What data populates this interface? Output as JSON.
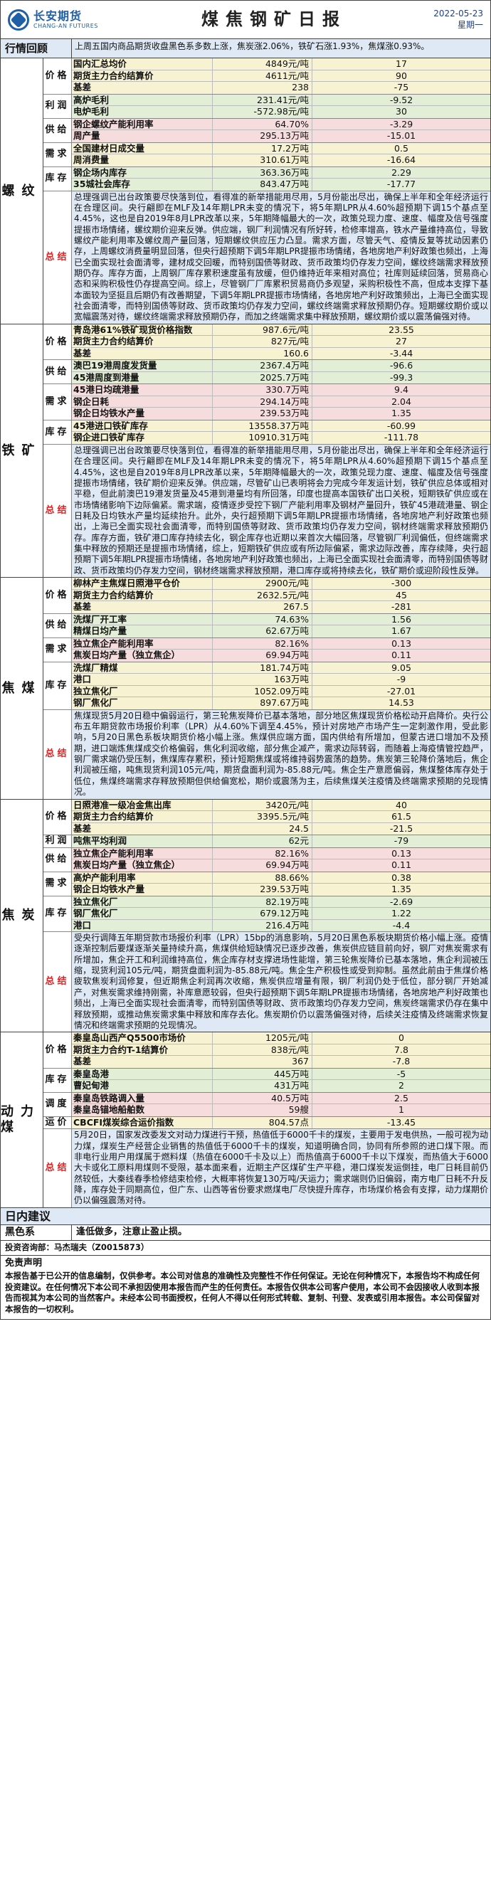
{
  "header": {
    "logo_cn": "长安期货",
    "logo_en": "CHANG-AN FUTURES",
    "title": "煤焦钢矿日报",
    "date": "2022-05-23",
    "weekday": "星期一"
  },
  "review": {
    "label": "行情回顾",
    "text": "上周五国内商品期货收盘黑色系多数上涨，焦炭涨2.06%，铁矿石涨1.93%，焦煤涨0.93%。"
  },
  "sections": {
    "rebar": {
      "name": "螺纹",
      "groups": [
        {
          "label": "价格",
          "rows": [
            {
              "name": "国内汇总均价",
              "value": "4849元/吨",
              "change": "17",
              "bg": "y"
            },
            {
              "name": "期货主力合约结算价",
              "value": "4611元/吨",
              "change": "90",
              "bg": "y"
            },
            {
              "name": "基差",
              "value": "238",
              "change": "-75",
              "bg": "y"
            }
          ]
        },
        {
          "label": "利润",
          "rows": [
            {
              "name": "高炉毛利",
              "value": "231.41元/吨",
              "change": "-9.52",
              "bg": "g"
            },
            {
              "name": "电炉毛利",
              "value": "-572.98元/吨",
              "change": "30",
              "bg": "g"
            }
          ]
        },
        {
          "label": "供给",
          "rows": [
            {
              "name": "钢企螺纹产能利用率",
              "value": "64.70%",
              "change": "-3.29",
              "bg": "p"
            },
            {
              "name": "周产量",
              "value": "295.13万吨",
              "change": "-15.01",
              "bg": "p"
            }
          ]
        },
        {
          "label": "需求",
          "rows": [
            {
              "name": "全国建材日成交量",
              "value": "17.2万吨",
              "change": "0.5",
              "bg": "y"
            },
            {
              "name": "周消费量",
              "value": "310.61万吨",
              "change": "-16.64",
              "bg": "y"
            }
          ]
        },
        {
          "label": "库存",
          "rows": [
            {
              "name": "钢企场内库存",
              "value": "363.36万吨",
              "change": "2.29",
              "bg": "g"
            },
            {
              "name": "35城社会库存",
              "value": "843.47万吨",
              "change": "-17.77",
              "bg": "g"
            }
          ]
        }
      ],
      "summary_label": "总结",
      "summary": "总理强调已出台政策要尽快落到位，看得准的新举措能用尽用，5月份能出尽出，确保上半年和全年经济运行在合理区间。央行翩即在MLF及14年期LPR未变的情况下，将5年期LPR从4.60%超预期下调15个基点至4.45%，这也是自2019年8月LPR改革以来，5年期降幅最大的一次，政策兑现力度、速度、幅度及信号强度提振市场情绪，螺纹期价迎来反弹。供应端，钢厂利润情况有所好转，检修率增高，铁水产量维持高位，导致螺纹产能利用率及螺纹周产量回落，短期螺纹供应压力凸显。需求方面，尽管天气、疫情反复等扰动因素仍存，上周螺纹消费量明显回落，但央行超预期下调5年期LPR提振市场情绪，各地房地产利好政策也频出，上海已全面实现社会面清零，建材成交回暖，而特别国债等财政、货币政策均仍存发力空间，螺纹终端需求释放预期仍存。库存方面，上周钢厂库存累积速度虽有放缓，但仍维持近年来相对高位；社库则延续回落，贸易商心态和采购积极性仍存提高空间。综上，尽管钢厂厂库累积贸易商仍多观望，采购积极性不高，但成本支撑下基本面较为坚挺且后期仍有改善期望，下调5年期LPR提振市场情绪，各地房地产利好政策频出，上海已全面实现社会面清零，而特别国债等财政、货币政策均仍存发力空间，螺纹终端需求释放预期仍存。短期螺纹期价或以宽幅震荡对待，螺纹终端需求释放预期仍存，而加之终端需求集中释放预期，螺纹期价或以震荡偏强对待。"
    },
    "ore": {
      "name": "铁矿",
      "groups": [
        {
          "label": "价格",
          "rows": [
            {
              "name": "青岛港61%铁矿现货价格指数",
              "value": "987.6元/吨",
              "change": "23.55",
              "bg": "y"
            },
            {
              "name": "期货主力合约结算价",
              "value": "827元/吨",
              "change": "27",
              "bg": "y"
            },
            {
              "name": "基差",
              "value": "160.6",
              "change": "-3.44",
              "bg": "y"
            }
          ]
        },
        {
          "label": "供给",
          "rows": [
            {
              "name": "澳巴19港周度发货量",
              "value": "2367.4万吨",
              "change": "-96.6",
              "bg": "g"
            },
            {
              "name": "45港周度到港量",
              "value": "2025.7万吨",
              "change": "-99.3",
              "bg": "g"
            }
          ]
        },
        {
          "label": "需求",
          "rows": [
            {
              "name": "45港日均疏港量",
              "value": "330.7万吨",
              "change": "9.4",
              "bg": "p"
            },
            {
              "name": "钢企日耗",
              "value": "294.14万吨",
              "change": "2.04",
              "bg": "p"
            },
            {
              "name": "钢企日均铁水产量",
              "value": "239.53万吨",
              "change": "1.35",
              "bg": "p"
            }
          ]
        },
        {
          "label": "库存",
          "rows": [
            {
              "name": "45港进口铁矿库存",
              "value": "13558.37万吨",
              "change": "-60.99",
              "bg": "y"
            },
            {
              "name": "钢企进口铁矿库存",
              "value": "10910.31万吨",
              "change": "-111.78",
              "bg": "y"
            }
          ]
        }
      ],
      "summary_label": "总结",
      "summary": "总理强调已出台政策要尽快落到位，看得准的新举措能用尽用，5月份能出尽出，确保上半年和全年经济运行在合理区间。央行翩即在MLF及14年期LPR未变的情况下，将5年期LPR从4.60%超预期下调15个基点至4.45%，这也是自2019年8月LPR改革以来，5年期降幅最大的一次，政策兑现力度、速度、幅度及信号强度提振市场情绪，铁矿期价迎来反弹。供应端，尽管矿山已表明将会力完成今年发运计划，铁矿供应总体或相对平稳，但此前澳巴19港发货量及45港到港量均有所回落，印度也提高本国铁矿出口关税，短期铁矿供应或在市场情绪影响下边际偏紧。需求端，疫情逐步受控下钢厂产能利用率及钢材产量回升，铁矿45港疏港量、钢企日耗及日均铁水产量均延续抬升。此外，央行超预期下调5年期LPR提振市场情绪，各地房地产利好政策也频出，上海已全面实现社会面清零，而特别国债等财政、货币政策均仍存发力空间，钢材终端需求释放预期仍存。库存方面，铁矿港口库存持续去化，钢企库存也近期以来首次大幅回落，尽管钢厂利润偏低，但终端需求集中释放的预期还是提振市场情绪，综上，短期铁矿供应或有所边际偏紧，需求边际改善，库存续降，央行超预期下调5年期LPR提振市场情绪，各地房地产利好政策也频出，上海已全面实现社会面清零，而特别国债等财政、货币政策均仍存发力空间，钢材终端需求释放预期，港口库存或将持续去化，铁矿期价或迎阶段性反弹。"
    },
    "coking_coal": {
      "name": "焦煤",
      "groups": [
        {
          "label": "价格",
          "rows": [
            {
              "name": "柳林产主焦煤日照港平仓价",
              "value": "2900元/吨",
              "change": "-300",
              "bg": "y"
            },
            {
              "name": "期货主力合约结算价",
              "value": "2632.5元/吨",
              "change": "45",
              "bg": "y"
            },
            {
              "name": "基差",
              "value": "267.5",
              "change": "-281",
              "bg": "y"
            }
          ]
        },
        {
          "label": "供给",
          "rows": [
            {
              "name": "洗煤厂开工率",
              "value": "74.63%",
              "change": "1.56",
              "bg": "g"
            },
            {
              "name": "精煤日均产量",
              "value": "62.67万吨",
              "change": "1.67",
              "bg": "g"
            }
          ]
        },
        {
          "label": "需求",
          "rows": [
            {
              "name": "独立焦企产能利用率",
              "value": "82.16%",
              "change": "0.13",
              "bg": "p"
            },
            {
              "name": "焦炭日均产量（独立焦企）",
              "value": "69.94万吨",
              "change": "0.11",
              "bg": "p"
            }
          ]
        },
        {
          "label": "库存",
          "rows": [
            {
              "name": "洗煤厂精煤",
              "value": "181.74万吨",
              "change": "9.05",
              "bg": "y"
            },
            {
              "name": "港口",
              "value": "163万吨",
              "change": "-9",
              "bg": "y"
            },
            {
              "name": "独立焦化厂",
              "value": "1052.09万吨",
              "change": "-27.01",
              "bg": "y"
            },
            {
              "name": "钢厂焦化厂",
              "value": "897.67万吨",
              "change": "14.53",
              "bg": "y"
            }
          ]
        }
      ],
      "summary_label": "总结",
      "summary": "焦煤现货5月20日稳中偏弱运行，第三轮焦炭降价已基本落地，部分地区焦煤现货价格松动开启降价。央行公布五年期贷款市场报价利率（LPR）从4.60%下调至4.45%，预计对房地产市场产生一定刺激作用，受此影响，5月20日黑色系板块期货价格小幅上涨。焦煤供应端方面，国内供给有所增加，但蒙古进口增加不及预期，进口端炼焦煤成交价格偏弱，焦化利润收缩，部分焦企减产，需求边际转弱，而随着上海疫情管控趋严，钢厂需求端仍受压制，焦煤库存累积，预计短期焦煤或将维持弱势震荡的趋势。焦炭第三轮降价落地后，焦企利润被压缩，吨焦现货利润105元/吨，期货盘面利润为-85.88元/吨。焦企生产意愿偏弱，焦煤整体库存处于低位，焦煤终端需求存释放预期但供给偏宽松，期价或震荡为主，后续焦煤关注疫情及终端需求预期的兑现情况。"
    },
    "coke": {
      "name": "焦炭",
      "groups": [
        {
          "label": "价格",
          "rows": [
            {
              "name": "日照港准一级冶金焦出库",
              "value": "3420元/吨",
              "change": "40",
              "bg": "y"
            },
            {
              "name": "期货主力合约结算价",
              "value": "3395.5元/吨",
              "change": "61.5",
              "bg": "y"
            },
            {
              "name": "基差",
              "value": "24.5",
              "change": "-21.5",
              "bg": "y"
            }
          ]
        },
        {
          "label": "利润",
          "rows": [
            {
              "name": "吨焦平均利润",
              "value": "62元",
              "change": "-79",
              "bg": "g"
            }
          ]
        },
        {
          "label": "供给",
          "rows": [
            {
              "name": "独立焦企产能利用率",
              "value": "82.16%",
              "change": "0.13",
              "bg": "p"
            },
            {
              "name": "焦炭日均产量（独立焦企）",
              "value": "69.94万吨",
              "change": "0.11",
              "bg": "p"
            }
          ]
        },
        {
          "label": "需求",
          "rows": [
            {
              "name": "高炉产能利用率",
              "value": "88.66%",
              "change": "0.38",
              "bg": "y"
            },
            {
              "name": "钢企日均铁水产量",
              "value": "239.53万吨",
              "change": "1.35",
              "bg": "y"
            }
          ]
        },
        {
          "label": "库存",
          "rows": [
            {
              "name": "独立焦化厂",
              "value": "82.19万吨",
              "change": "-2.69",
              "bg": "g"
            },
            {
              "name": "钢厂焦化厂",
              "value": "679.12万吨",
              "change": "1.22",
              "bg": "g"
            },
            {
              "name": "港口",
              "value": "216.4万吨",
              "change": "-4.4",
              "bg": "g"
            }
          ]
        }
      ],
      "summary_label": "总结",
      "summary": "受央行调降五年期贷款市场报价利率（LPR）15bp的消息影响，5月20日黑色系板块期货价格小幅上涨。疫情逐渐控制后要煤逐渐关量持续升高，焦煤供给短缺情况已逐步改善，焦炭供应链目前向好，钢厂对焦炭需求有所增加，焦企开工和利润维持高位，焦企库存材支撑进场性能增，第三轮焦炭降价已基本落地，焦企利润被压缩，现货利润105元/吨，期货盘面利润为-85.88元/吨。焦企生产积极性或受到抑制。虽然此前由于焦煤价格疲软焦炭利润修复，但近期焦企利润再次收缩，焦炭供应增量有限，钢厂利润仍处于低位，部分钢厂开始减产，对焦炭需求维持刚需，补库意愿较弱，但央行超预期下调5年期LPR提振市场情绪，各地房地产利好政策也频出，上海已全面实现社会面清零，而特别国债等财政、货币政策均仍存发力空间，焦炭终端需求仍存在集中释放预期，或推动焦炭需求集中释放和库存去化。焦炭期价仍以震荡偏强对待，后续关注疫情及终端需求恢复情况和终端需求预期的兑现情况。"
    },
    "thermal_coal": {
      "name": "动力煤",
      "groups": [
        {
          "label": "价格",
          "rows": [
            {
              "name": "秦皇岛山西产Q5500市场价",
              "value": "1205元/吨",
              "change": "0",
              "bg": "y"
            },
            {
              "name": "期货主力合约T-1结算价",
              "value": "838元/吨",
              "change": "7.8",
              "bg": "y"
            },
            {
              "name": "基差",
              "value": "367",
              "change": "-7.8",
              "bg": "y"
            }
          ]
        },
        {
          "label": "库存",
          "rows": [
            {
              "name": "秦皇岛港",
              "value": "445万吨",
              "change": "-5",
              "bg": "g"
            },
            {
              "name": "曹妃甸港",
              "value": "431万吨",
              "change": "2",
              "bg": "g"
            }
          ]
        },
        {
          "label": "调度",
          "rows": [
            {
              "name": "秦皇岛铁路调入量",
              "value": "40.5万吨",
              "change": "2.5",
              "bg": "p"
            },
            {
              "name": "秦皇岛锚地船舶数",
              "value": "59艘",
              "change": "1",
              "bg": "p"
            }
          ]
        },
        {
          "label": "运价",
          "rows": [
            {
              "name": "CBCFI煤炭综合运价指数",
              "value": "804.57点",
              "change": "-13.45",
              "bg": "y"
            }
          ]
        }
      ],
      "summary_label": "总结",
      "summary": "5月20日，国家发改委发文对动力煤进行干预，热值低于6000千卡的煤炭，主要用于发电供热，一般可视为动力煤，煤炭生产经营企业销售的热值低于6000千卡的煤炭，知道明确合同，协同有所参照的进口煤下限。而非电行业用户用煤属于燃料煤（热值在6000千卡及以上）而热值高于6000千卡以下煤炭，而热值大于6000大卡或化工原料用煤则不受限，基本面来看，近期主产区煤矿生产平稳，港口煤炭发运倒挂，电厂日耗目前仍然较低，大秦线春季检修结束检修，大概率将恢复130万吨/天运力；需求端则仍旧偏弱，南方电厂日耗不升反降，库存处于同期高位，但广东、山西等省份要求燃煤电厂尽快提升库存，市场煤价格会有支撑，动力煤期价仍以偏强震荡对待。"
    }
  },
  "advice": {
    "head": "日内建议",
    "name": "黑色系",
    "text": "逢低做多，注意止盈止损。"
  },
  "author": "投资咨询部：马杰瑞夫（Z0015873）",
  "disclaimer": {
    "title": "免责声明",
    "text": "本报告基于已公开的信息编制，仅供参考。本公司对信息的准确性及完整性不作任何保证。无论在何种情况下，本报告均不构成任何投资建议。在任何情况下本公司不承担因使用本报告而产生的任何责任。本报告仅供本公司客户使用，本公司不会因接收人收到本报告而视其为本公司的当然客户。未经本公司书面授权，任何人不得以任何形式转载、复制、刊登、发表或引用本报告。本公司保留对本报告的一切权利。"
  }
}
